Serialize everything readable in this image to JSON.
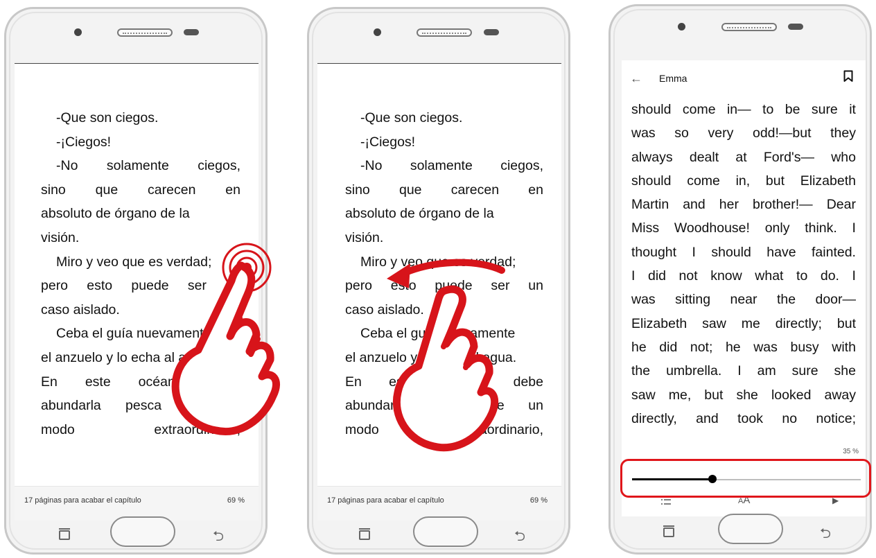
{
  "phone1": {
    "lines": [
      {
        "indent": true,
        "words": [
          "-Que son ciegos."
        ]
      },
      {
        "indent": true,
        "words": [
          "-¡Ciegos!"
        ]
      },
      {
        "indent": true,
        "words": [
          "-No",
          "solamente",
          "ciegos,"
        ]
      },
      {
        "indent": false,
        "words": [
          "sino",
          "que",
          "carecen",
          "en"
        ]
      },
      {
        "indent": false,
        "words": [
          "absoluto de órgano de la"
        ]
      },
      {
        "indent": false,
        "words": [
          "visión."
        ]
      },
      {
        "indent": true,
        "words": [
          "Miro y veo que es verdad;"
        ]
      },
      {
        "indent": false,
        "words": [
          "pero",
          "esto",
          "puede",
          "ser",
          "un"
        ]
      },
      {
        "indent": false,
        "words": [
          "caso aislado."
        ]
      },
      {
        "indent": true,
        "words": [
          "Ceba el guía nuevamente"
        ]
      },
      {
        "indent": false,
        "words": [
          "el anzuelo y lo echa al agua."
        ]
      },
      {
        "indent": false,
        "words": [
          "En",
          "este",
          "océano",
          "debe"
        ]
      },
      {
        "indent": false,
        "words": [
          "abundarla",
          "pesca",
          "de",
          "un"
        ]
      },
      {
        "indent": false,
        "words": [
          "modo",
          "extraordinario,"
        ]
      }
    ],
    "footer_left": "17 páginas para acabar el capítulo",
    "footer_right": "69 %"
  },
  "phone2": {
    "lines": [
      {
        "indent": true,
        "words": [
          "-Que son ciegos."
        ]
      },
      {
        "indent": true,
        "words": [
          "-¡Ciegos!"
        ]
      },
      {
        "indent": true,
        "words": [
          "-No",
          "solamente",
          "ciegos,"
        ]
      },
      {
        "indent": false,
        "words": [
          "sino",
          "que",
          "carecen",
          "en"
        ]
      },
      {
        "indent": false,
        "words": [
          "absoluto de órgano de la"
        ]
      },
      {
        "indent": false,
        "words": [
          "visión."
        ]
      },
      {
        "indent": true,
        "words": [
          "Miro y veo que es verdad;"
        ]
      },
      {
        "indent": false,
        "words": [
          "pero",
          "esto",
          "puede",
          "ser",
          "un"
        ]
      },
      {
        "indent": false,
        "words": [
          "caso aislado."
        ]
      },
      {
        "indent": true,
        "words": [
          "Ceba el guía nuevamente"
        ]
      },
      {
        "indent": false,
        "words": [
          "el anzuelo y lo echa al agua."
        ]
      },
      {
        "indent": false,
        "words": [
          "En",
          "este",
          "océano",
          "debe"
        ]
      },
      {
        "indent": false,
        "words": [
          "abundarla",
          "pesca",
          "de",
          "un"
        ]
      },
      {
        "indent": false,
        "words": [
          "modo",
          "extraordinario,"
        ]
      }
    ],
    "footer_left": "17 páginas para acabar el capítulo",
    "footer_right": "69 %"
  },
  "phone3": {
    "header": {
      "back_icon": "arrow-left-icon",
      "title": "Emma",
      "bookmark_icon": "bookmark-icon"
    },
    "lines": [
      {
        "words": [
          "should",
          "come",
          "in—",
          "to",
          "be",
          "sure",
          "it"
        ]
      },
      {
        "words": [
          "was",
          "so",
          "very",
          "odd!—but",
          "they"
        ]
      },
      {
        "words": [
          "always",
          "dealt",
          "at",
          "Ford's—",
          "who"
        ]
      },
      {
        "words": [
          "should",
          "come",
          "in,",
          "but",
          "Elizabeth"
        ]
      },
      {
        "words": [
          "Martin",
          "and",
          "her",
          "brother!—",
          "Dear"
        ]
      },
      {
        "words": [
          "Miss",
          "Woodhouse!",
          "only",
          "think.",
          "I"
        ]
      },
      {
        "words": [
          "thought",
          "I",
          "should",
          "have",
          "fainted."
        ]
      },
      {
        "words": [
          "I",
          "did",
          "not",
          "know",
          "what",
          "to",
          "do.",
          "I"
        ]
      },
      {
        "words": [
          "was",
          "sitting",
          "near",
          "the",
          "door—"
        ]
      },
      {
        "words": [
          "Elizabeth",
          "saw",
          "me",
          "directly;",
          "but"
        ]
      },
      {
        "words": [
          "he",
          "did",
          "not;",
          "he",
          "was",
          "busy",
          "with"
        ]
      },
      {
        "words": [
          "the",
          "umbrella.",
          "I",
          "am",
          "sure",
          "she"
        ]
      },
      {
        "words": [
          "saw",
          "me,",
          "but",
          "she",
          "looked",
          "away"
        ]
      },
      {
        "words": [
          "directly,",
          "and",
          "took",
          "no",
          "notice;"
        ]
      }
    ],
    "progress_label": "35 %",
    "progress_fraction": 0.35,
    "toolbar_icons": [
      "list-icon",
      "font-size-icon",
      "play-icon"
    ],
    "highlight_color": "#e0161b"
  },
  "colors": {
    "hand_red": "#d7141a",
    "highlight_red": "#e0161b",
    "text": "#111111"
  }
}
